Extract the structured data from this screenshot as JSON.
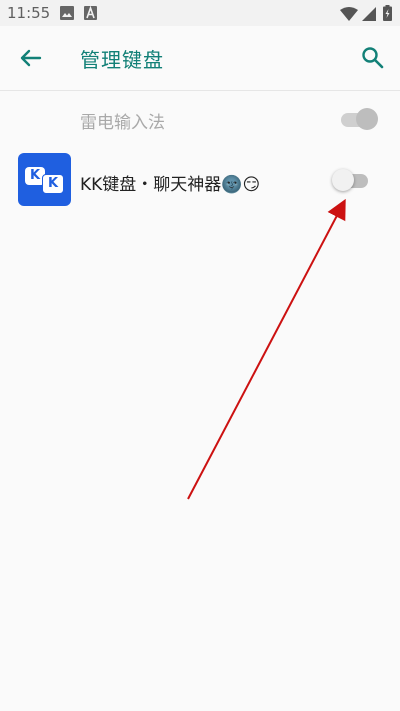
{
  "status_bar": {
    "time": "11:55",
    "left_icons": [
      "image-icon",
      "a-letter-icon"
    ],
    "right_icons": [
      "wifi-icon",
      "signal-icon",
      "battery-icon"
    ]
  },
  "app_bar": {
    "title": "管理键盘",
    "back_icon": "arrow-left-icon",
    "search_icon": "search-icon",
    "accent_color": "#128077"
  },
  "keyboards": [
    {
      "name": "雷电输入法",
      "enabled": true,
      "disabled_state": true
    },
    {
      "name": "KK键盘・聊天神器",
      "emoji": "🌚😏",
      "enabled": false,
      "disabled_state": false,
      "icon_text": "KK"
    }
  ],
  "colors": {
    "annotation_arrow": "#cc1111",
    "app_icon_bg": "#1f5fe0"
  }
}
